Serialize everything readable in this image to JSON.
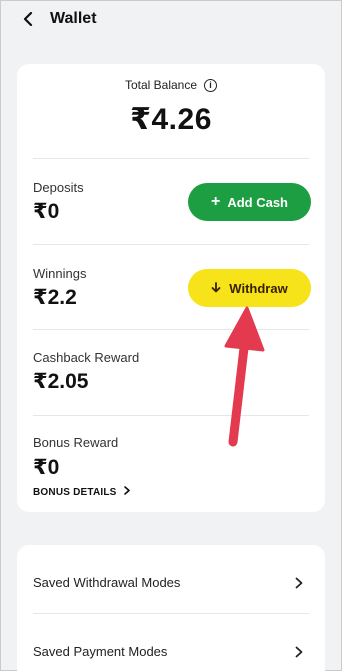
{
  "header": {
    "title": "Wallet"
  },
  "balance": {
    "label": "Total Balance",
    "amount": "₹4.26"
  },
  "deposits": {
    "label": "Deposits",
    "value": "₹0",
    "button_label": "Add Cash"
  },
  "winnings": {
    "label": "Winnings",
    "value": "₹2.2",
    "button_label": "Withdraw"
  },
  "cashback": {
    "label": "Cashback Reward",
    "value": "₹2.05"
  },
  "bonus": {
    "label": "Bonus Reward",
    "value": "₹0",
    "details_link": "BONUS DETAILS"
  },
  "links": [
    {
      "label": "Saved Withdrawal Modes"
    },
    {
      "label": "Saved Payment Modes"
    }
  ],
  "colors": {
    "add_cash_button": "#1e9e43",
    "withdraw_button": "#f6e319",
    "annotation_arrow": "#e43a4f",
    "background": "#f1f2f4"
  },
  "icons": {
    "back": "back-arrow-icon",
    "info": "info-icon",
    "add": "plus-icon",
    "withdraw": "down-arrow-icon",
    "chevron": "chevron-right-icon"
  }
}
